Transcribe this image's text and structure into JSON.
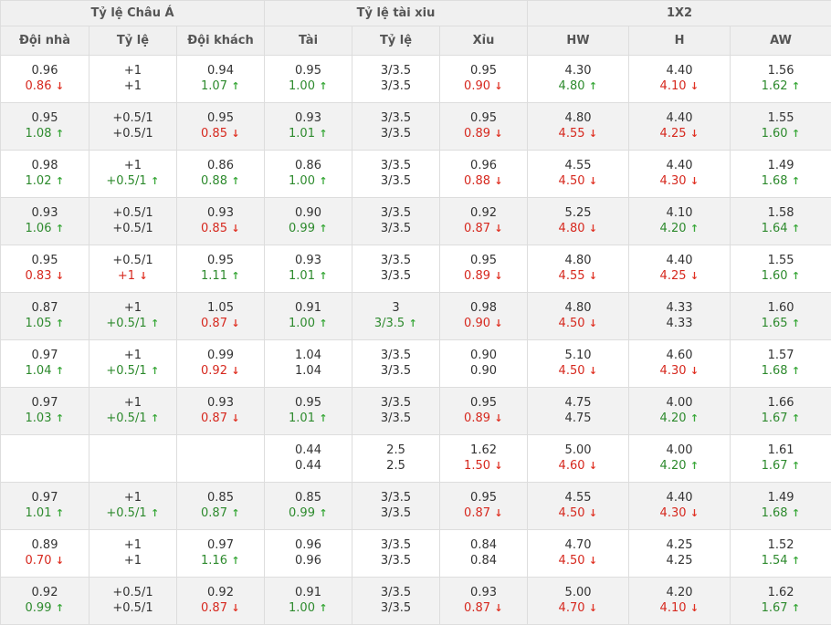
{
  "header": {
    "groups": [
      "Tỷ lệ Châu Á",
      "Tỷ lệ tài xiu",
      "1X2"
    ],
    "columns": [
      "Đội nhà",
      "Tỷ lệ",
      "Đội khách",
      "Tài",
      "Tỷ lệ",
      "Xỉu",
      "HW",
      "H",
      "AW"
    ]
  },
  "rows": [
    [
      [
        "0.96",
        "flat"
      ],
      [
        "+1",
        "flat"
      ],
      [
        "0.94",
        "flat"
      ],
      [
        "0.95",
        "flat"
      ],
      [
        "3/3.5",
        "flat"
      ],
      [
        "0.95",
        "flat"
      ],
      [
        "4.30",
        "flat"
      ],
      [
        "4.40",
        "flat"
      ],
      [
        "1.56",
        "flat"
      ]
    ],
    [
      [
        "0.86",
        "down"
      ],
      [
        "+1",
        "flat"
      ],
      [
        "1.07",
        "up"
      ],
      [
        "1.00",
        "up"
      ],
      [
        "3/3.5",
        "flat"
      ],
      [
        "0.90",
        "down"
      ],
      [
        "4.80",
        "up"
      ],
      [
        "4.10",
        "down"
      ],
      [
        "1.62",
        "up"
      ]
    ],
    [
      [
        "0.95",
        "flat"
      ],
      [
        "+0.5/1",
        "flat"
      ],
      [
        "0.95",
        "flat"
      ],
      [
        "0.93",
        "flat"
      ],
      [
        "3/3.5",
        "flat"
      ],
      [
        "0.95",
        "flat"
      ],
      [
        "4.80",
        "flat"
      ],
      [
        "4.40",
        "flat"
      ],
      [
        "1.55",
        "flat"
      ]
    ],
    [
      [
        "1.08",
        "up"
      ],
      [
        "+0.5/1",
        "flat"
      ],
      [
        "0.85",
        "down"
      ],
      [
        "1.01",
        "up"
      ],
      [
        "3/3.5",
        "flat"
      ],
      [
        "0.89",
        "down"
      ],
      [
        "4.55",
        "down"
      ],
      [
        "4.25",
        "down"
      ],
      [
        "1.60",
        "up"
      ]
    ],
    [
      [
        "0.98",
        "flat"
      ],
      [
        "+1",
        "flat"
      ],
      [
        "0.86",
        "flat"
      ],
      [
        "0.86",
        "flat"
      ],
      [
        "3/3.5",
        "flat"
      ],
      [
        "0.96",
        "flat"
      ],
      [
        "4.55",
        "flat"
      ],
      [
        "4.40",
        "flat"
      ],
      [
        "1.49",
        "flat"
      ]
    ],
    [
      [
        "1.02",
        "up"
      ],
      [
        "+0.5/1",
        "up"
      ],
      [
        "0.88",
        "up"
      ],
      [
        "1.00",
        "up"
      ],
      [
        "3/3.5",
        "flat"
      ],
      [
        "0.88",
        "down"
      ],
      [
        "4.50",
        "down"
      ],
      [
        "4.30",
        "down"
      ],
      [
        "1.68",
        "up"
      ]
    ],
    [
      [
        "0.93",
        "flat"
      ],
      [
        "+0.5/1",
        "flat"
      ],
      [
        "0.93",
        "flat"
      ],
      [
        "0.90",
        "flat"
      ],
      [
        "3/3.5",
        "flat"
      ],
      [
        "0.92",
        "flat"
      ],
      [
        "5.25",
        "flat"
      ],
      [
        "4.10",
        "flat"
      ],
      [
        "1.58",
        "flat"
      ]
    ],
    [
      [
        "1.06",
        "up"
      ],
      [
        "+0.5/1",
        "flat"
      ],
      [
        "0.85",
        "down"
      ],
      [
        "0.99",
        "up"
      ],
      [
        "3/3.5",
        "flat"
      ],
      [
        "0.87",
        "down"
      ],
      [
        "4.80",
        "down"
      ],
      [
        "4.20",
        "up"
      ],
      [
        "1.64",
        "up"
      ]
    ],
    [
      [
        "0.95",
        "flat"
      ],
      [
        "+0.5/1",
        "flat"
      ],
      [
        "0.95",
        "flat"
      ],
      [
        "0.93",
        "flat"
      ],
      [
        "3/3.5",
        "flat"
      ],
      [
        "0.95",
        "flat"
      ],
      [
        "4.80",
        "flat"
      ],
      [
        "4.40",
        "flat"
      ],
      [
        "1.55",
        "flat"
      ]
    ],
    [
      [
        "0.83",
        "down"
      ],
      [
        "+1",
        "down"
      ],
      [
        "1.11",
        "up"
      ],
      [
        "1.01",
        "up"
      ],
      [
        "3/3.5",
        "flat"
      ],
      [
        "0.89",
        "down"
      ],
      [
        "4.55",
        "down"
      ],
      [
        "4.25",
        "down"
      ],
      [
        "1.60",
        "up"
      ]
    ],
    [
      [
        "0.87",
        "flat"
      ],
      [
        "+1",
        "flat"
      ],
      [
        "1.05",
        "flat"
      ],
      [
        "0.91",
        "flat"
      ],
      [
        "3",
        "flat"
      ],
      [
        "0.98",
        "flat"
      ],
      [
        "4.80",
        "flat"
      ],
      [
        "4.33",
        "flat"
      ],
      [
        "1.60",
        "flat"
      ]
    ],
    [
      [
        "1.05",
        "up"
      ],
      [
        "+0.5/1",
        "up"
      ],
      [
        "0.87",
        "down"
      ],
      [
        "1.00",
        "up"
      ],
      [
        "3/3.5",
        "up"
      ],
      [
        "0.90",
        "down"
      ],
      [
        "4.50",
        "down"
      ],
      [
        "4.33",
        "flat"
      ],
      [
        "1.65",
        "up"
      ]
    ],
    [
      [
        "0.97",
        "flat"
      ],
      [
        "+1",
        "flat"
      ],
      [
        "0.99",
        "flat"
      ],
      [
        "1.04",
        "flat"
      ],
      [
        "3/3.5",
        "flat"
      ],
      [
        "0.90",
        "flat"
      ],
      [
        "5.10",
        "flat"
      ],
      [
        "4.60",
        "flat"
      ],
      [
        "1.57",
        "flat"
      ]
    ],
    [
      [
        "1.04",
        "up"
      ],
      [
        "+0.5/1",
        "up"
      ],
      [
        "0.92",
        "down"
      ],
      [
        "1.04",
        "flat"
      ],
      [
        "3/3.5",
        "flat"
      ],
      [
        "0.90",
        "flat"
      ],
      [
        "4.50",
        "down"
      ],
      [
        "4.30",
        "down"
      ],
      [
        "1.68",
        "up"
      ]
    ],
    [
      [
        "0.97",
        "flat"
      ],
      [
        "+1",
        "flat"
      ],
      [
        "0.93",
        "flat"
      ],
      [
        "0.95",
        "flat"
      ],
      [
        "3/3.5",
        "flat"
      ],
      [
        "0.95",
        "flat"
      ],
      [
        "4.75",
        "flat"
      ],
      [
        "4.00",
        "flat"
      ],
      [
        "1.66",
        "flat"
      ]
    ],
    [
      [
        "1.03",
        "up"
      ],
      [
        "+0.5/1",
        "up"
      ],
      [
        "0.87",
        "down"
      ],
      [
        "1.01",
        "up"
      ],
      [
        "3/3.5",
        "flat"
      ],
      [
        "0.89",
        "down"
      ],
      [
        "4.75",
        "flat"
      ],
      [
        "4.20",
        "up"
      ],
      [
        "1.67",
        "up"
      ]
    ],
    [
      [
        "",
        "flat"
      ],
      [
        "",
        "flat"
      ],
      [
        "",
        "flat"
      ],
      [
        "0.44",
        "flat"
      ],
      [
        "2.5",
        "flat"
      ],
      [
        "1.62",
        "flat"
      ],
      [
        "5.00",
        "flat"
      ],
      [
        "4.00",
        "flat"
      ],
      [
        "1.61",
        "flat"
      ]
    ],
    [
      [
        "",
        "flat"
      ],
      [
        "",
        "flat"
      ],
      [
        "",
        "flat"
      ],
      [
        "0.44",
        "flat"
      ],
      [
        "2.5",
        "flat"
      ],
      [
        "1.50",
        "down"
      ],
      [
        "4.60",
        "down"
      ],
      [
        "4.20",
        "up"
      ],
      [
        "1.67",
        "up"
      ]
    ],
    [
      [
        "0.97",
        "flat"
      ],
      [
        "+1",
        "flat"
      ],
      [
        "0.85",
        "flat"
      ],
      [
        "0.85",
        "flat"
      ],
      [
        "3/3.5",
        "flat"
      ],
      [
        "0.95",
        "flat"
      ],
      [
        "4.55",
        "flat"
      ],
      [
        "4.40",
        "flat"
      ],
      [
        "1.49",
        "flat"
      ]
    ],
    [
      [
        "1.01",
        "up"
      ],
      [
        "+0.5/1",
        "up"
      ],
      [
        "0.87",
        "up"
      ],
      [
        "0.99",
        "up"
      ],
      [
        "3/3.5",
        "flat"
      ],
      [
        "0.87",
        "down"
      ],
      [
        "4.50",
        "down"
      ],
      [
        "4.30",
        "down"
      ],
      [
        "1.68",
        "up"
      ]
    ],
    [
      [
        "0.89",
        "flat"
      ],
      [
        "+1",
        "flat"
      ],
      [
        "0.97",
        "flat"
      ],
      [
        "0.96",
        "flat"
      ],
      [
        "3/3.5",
        "flat"
      ],
      [
        "0.84",
        "flat"
      ],
      [
        "4.70",
        "flat"
      ],
      [
        "4.25",
        "flat"
      ],
      [
        "1.52",
        "flat"
      ]
    ],
    [
      [
        "0.70",
        "down"
      ],
      [
        "+1",
        "flat"
      ],
      [
        "1.16",
        "up"
      ],
      [
        "0.96",
        "flat"
      ],
      [
        "3/3.5",
        "flat"
      ],
      [
        "0.84",
        "flat"
      ],
      [
        "4.50",
        "down"
      ],
      [
        "4.25",
        "flat"
      ],
      [
        "1.54",
        "up"
      ]
    ],
    [
      [
        "0.92",
        "flat"
      ],
      [
        "+0.5/1",
        "flat"
      ],
      [
        "0.92",
        "flat"
      ],
      [
        "0.91",
        "flat"
      ],
      [
        "3/3.5",
        "flat"
      ],
      [
        "0.93",
        "flat"
      ],
      [
        "5.00",
        "flat"
      ],
      [
        "4.20",
        "flat"
      ],
      [
        "1.62",
        "flat"
      ]
    ],
    [
      [
        "0.99",
        "up"
      ],
      [
        "+0.5/1",
        "flat"
      ],
      [
        "0.87",
        "down"
      ],
      [
        "1.00",
        "up"
      ],
      [
        "3/3.5",
        "flat"
      ],
      [
        "0.87",
        "down"
      ],
      [
        "4.70",
        "down"
      ],
      [
        "4.10",
        "down"
      ],
      [
        "1.67",
        "up"
      ]
    ]
  ]
}
